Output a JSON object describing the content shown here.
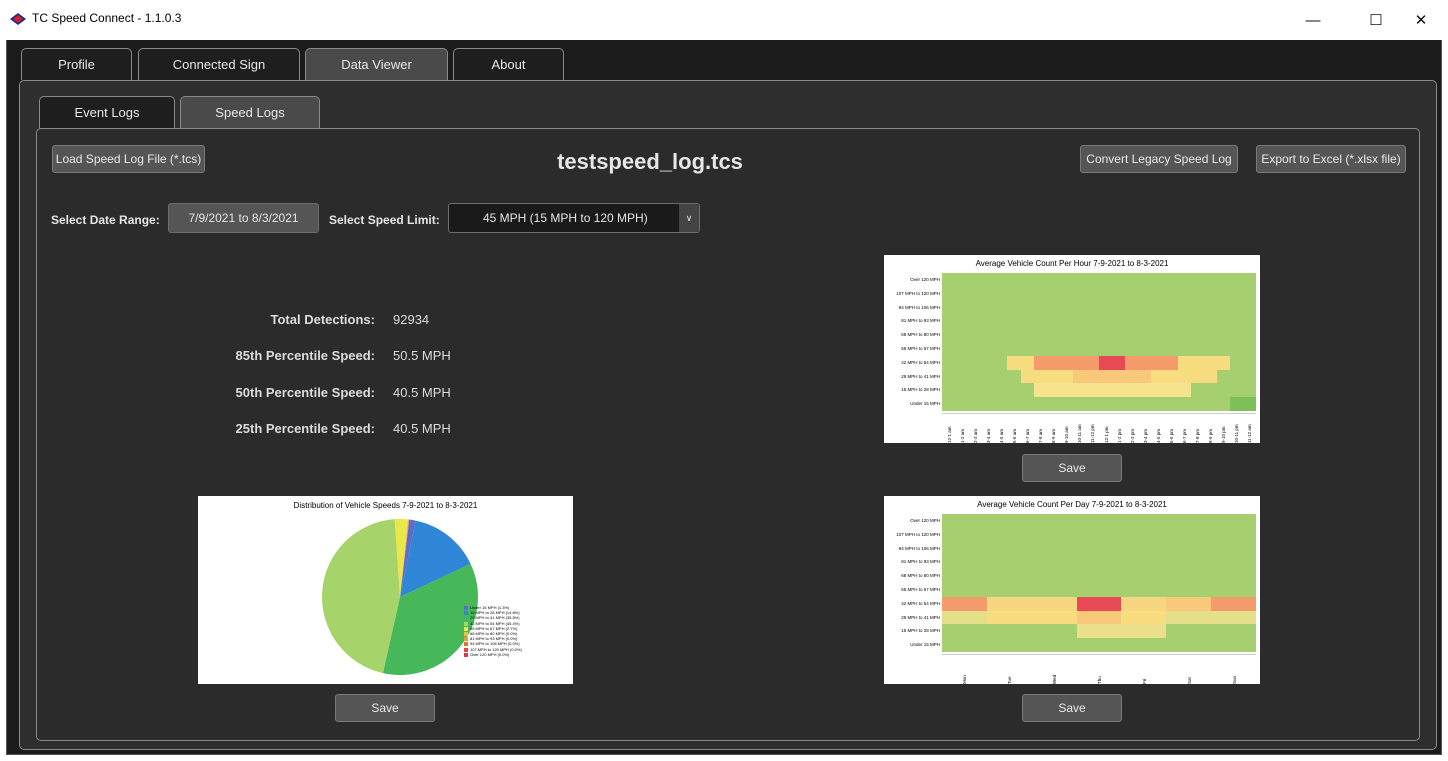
{
  "window": {
    "title": "TC Speed Connect - 1.1.0.3",
    "minimize": "—",
    "maximize": "☐",
    "close": "✕"
  },
  "main_tabs": [
    {
      "label": "Profile",
      "active": false
    },
    {
      "label": "Connected Sign",
      "active": false
    },
    {
      "label": "Data Viewer",
      "active": true
    },
    {
      "label": "About",
      "active": false
    }
  ],
  "sub_tabs": [
    {
      "label": "Event Logs",
      "active": false
    },
    {
      "label": "Speed Logs",
      "active": true
    }
  ],
  "toolbar": {
    "load_label": "Load Speed Log File (*.tcs)",
    "file_title": "testspeed_log.tcs",
    "convert_label": "Convert Legacy Speed Log",
    "export_label": "Export to Excel (*.xlsx file)"
  },
  "filters": {
    "date_range_label": "Select Date Range:",
    "date_range_value": "7/9/2021 to 8/3/2021",
    "speed_limit_label": "Select Speed Limit:",
    "speed_limit_value": "45 MPH (15 MPH to 120 MPH)"
  },
  "stats": [
    {
      "label": "Total Detections:",
      "value": "92934"
    },
    {
      "label": "85th Percentile Speed:",
      "value": "50.5 MPH"
    },
    {
      "label": "50th Percentile Speed:",
      "value": "40.5 MPH"
    },
    {
      "label": "25th Percentile Speed:",
      "value": "40.5 MPH"
    }
  ],
  "save_label": "Save",
  "colors": {
    "bg": "#2e2e2e",
    "button": "#555555",
    "heat_low": "#a6cf6f",
    "heat_mid": "#f7dd7f",
    "heat_high": "#f0705a"
  },
  "chart_data": [
    {
      "type": "pie",
      "title": "Distribution of Vehicle Speeds 7-9-2021 to 8-3-2021",
      "legend_position": "right",
      "categories": [
        "Under 15 MPH (1.3%)",
        "15 MPH to 28 MPH (14.8%)",
        "29 MPH to 41 MPH (35.5%)",
        "42 MPH to 54 MPH (45.4%)",
        "55 MPH to 67 MPH (2.7%)",
        "68 MPH to 80 MPH (0.0%)",
        "81 MPH to 93 MPH (0.0%)",
        "94 MPH to 106 MPH (0.0%)",
        "107 MPH to 120 MPH (0.0%)",
        "Over 120 MPH (0.0%)"
      ],
      "values": [
        1.3,
        14.8,
        35.5,
        45.4,
        2.7,
        0.1,
        0.1,
        0.05,
        0.03,
        0.02
      ],
      "colors": [
        "#5a6ec8",
        "#2f86d6",
        "#47b85a",
        "#a6d36a",
        "#e8e84a",
        "#f2c04a",
        "#f09a3a",
        "#ec6f3a",
        "#e04a3a",
        "#d43a4a"
      ]
    },
    {
      "type": "heatmap",
      "title": "Average Vehicle Count Per Hour  7-9-2021 to 8-3-2021",
      "y_categories": [
        "Over 120 MPH",
        "107 MPH to 120 MPH",
        "94 MPH to 106 MPH",
        "81 MPH to 93 MPH",
        "68 MPH to 80 MPH",
        "55 MPH to 67 MPH",
        "42 MPH to 54 MPH",
        "29 MPH to 41 MPH",
        "15 MPH to 28 MPH",
        "Under 15 MPH"
      ],
      "x_categories": [
        "12-1 am",
        "1-2 am",
        "2-3 am",
        "3-4 am",
        "4-5 am",
        "5-6 am",
        "6-7 am",
        "7-8 am",
        "8-9 am",
        "9-10 am",
        "10-11 am",
        "11-12 pm",
        "12-1 pm",
        "1-2 pm",
        "2-3 pm",
        "3-4 pm",
        "4-5 pm",
        "5-6 pm",
        "6-7 pm",
        "7-8 pm",
        "8-9 pm",
        "9-10 pm",
        "10-11 pm",
        "11-12 am"
      ]
    },
    {
      "type": "heatmap",
      "title": "Average Vehicle Count Per Day  7-9-2021 to 8-3-2021",
      "y_categories": [
        "Over 120 MPH",
        "107 MPH to 120 MPH",
        "94 MPH to 106 MPH",
        "81 MPH to 93 MPH",
        "68 MPH to 80 MPH",
        "55 MPH to 67 MPH",
        "42 MPH to 54 MPH",
        "29 MPH to 41 MPH",
        "15 MPH to 28 MPH",
        "Under 15 MPH"
      ],
      "x_categories": [
        "Mon",
        "Tue",
        "Wed",
        "Thu",
        "Fri",
        "Sat",
        "Sun"
      ]
    }
  ]
}
